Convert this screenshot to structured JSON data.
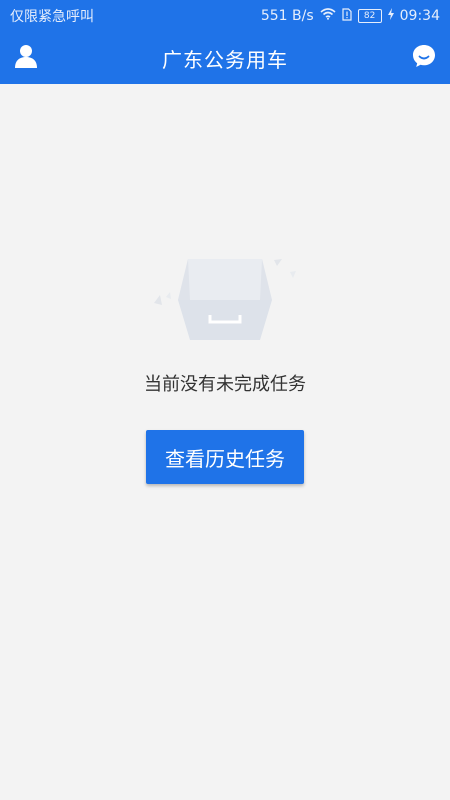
{
  "status_bar": {
    "left_text": "仅限紧急呼叫",
    "speed": "551 B/s",
    "battery": "82",
    "time": "09:34"
  },
  "header": {
    "title": "广东公务用车",
    "left_icon": "user-icon",
    "right_icon": "chat-bubble-icon"
  },
  "empty_state": {
    "message": "当前没有未完成任务",
    "button_label": "查看历史任务"
  },
  "colors": {
    "primary": "#1f73e8",
    "background": "#f3f3f3"
  }
}
